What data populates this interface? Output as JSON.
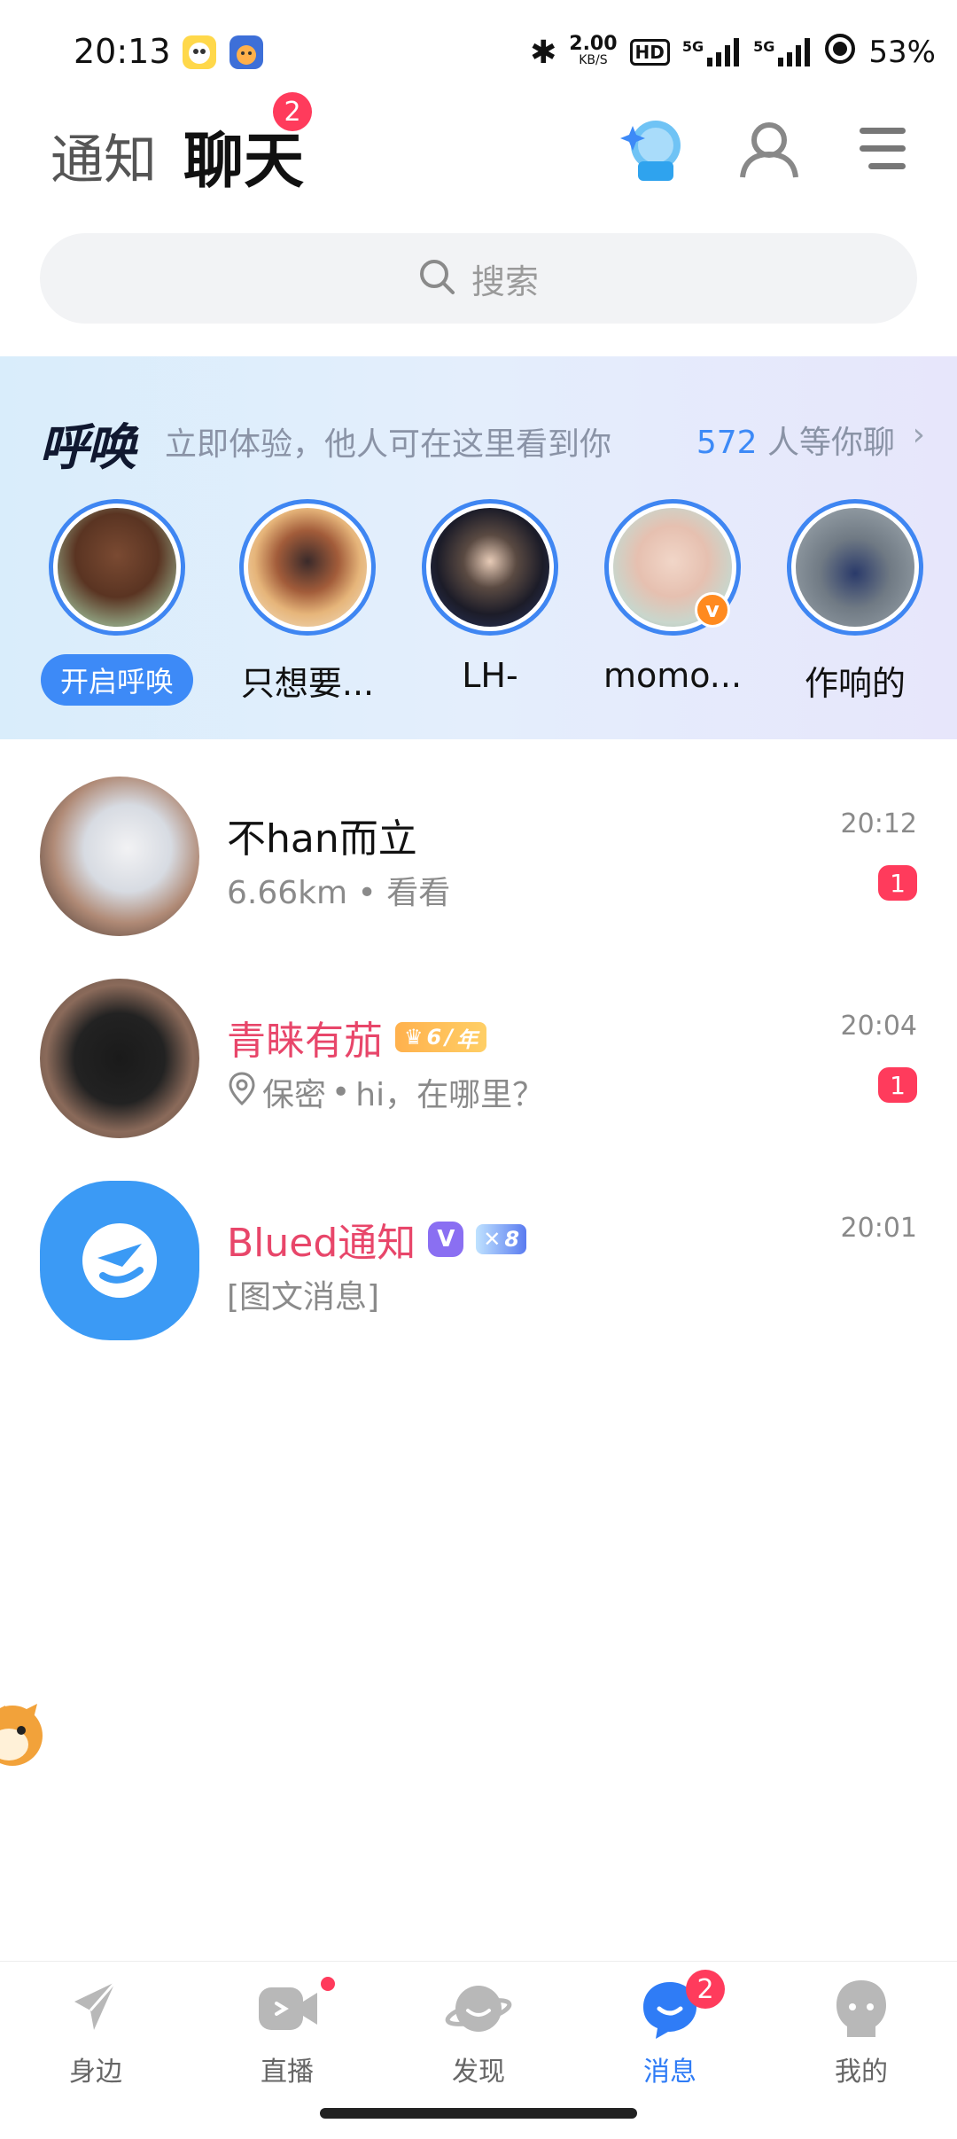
{
  "status_bar": {
    "time": "20:13",
    "network_speed": "2.00",
    "network_unit": "KB/S",
    "hd_label": "HD",
    "sim1_label": "5G",
    "sim2_label": "5G",
    "battery": "53%"
  },
  "header": {
    "tab_notify": "通知",
    "tab_chat": "聊天",
    "chat_badge": "2"
  },
  "search": {
    "placeholder": "搜索"
  },
  "call_banner": {
    "logo_text": "呼唤",
    "description": "立即体验，他人可在这里看到你",
    "count": "572",
    "count_suffix": "人等你聊",
    "open_button": "开启呼唤",
    "stories": [
      {
        "label": "只想要..."
      },
      {
        "label": "LH-"
      },
      {
        "label": "momo..."
      },
      {
        "label": "作响的"
      }
    ]
  },
  "conversations": [
    {
      "name": "不han而立",
      "distance": "6.66km",
      "separator": "•",
      "message": "看看",
      "time": "20:12",
      "unread": "1"
    },
    {
      "name": "青睐有茄",
      "vip_label": "6",
      "vip_suffix": "年",
      "location": "保密",
      "separator": "•",
      "message": "hi，在哪里？",
      "time": "20:04",
      "unread": "1"
    },
    {
      "name": "Blued通知",
      "verified_label": "V",
      "level_label": "8",
      "message": "[图文消息]",
      "time": "20:01"
    }
  ],
  "bottom_nav": {
    "items": [
      {
        "label": "身边"
      },
      {
        "label": "直播"
      },
      {
        "label": "发现"
      },
      {
        "label": "消息"
      },
      {
        "label": "我的"
      }
    ],
    "messages_badge": "2"
  },
  "colors": {
    "accent_blue": "#3d8af7",
    "badge_red": "#ff3b5c",
    "vip_name_pink": "#e8466a",
    "vip_orange": "#ffb14d"
  }
}
